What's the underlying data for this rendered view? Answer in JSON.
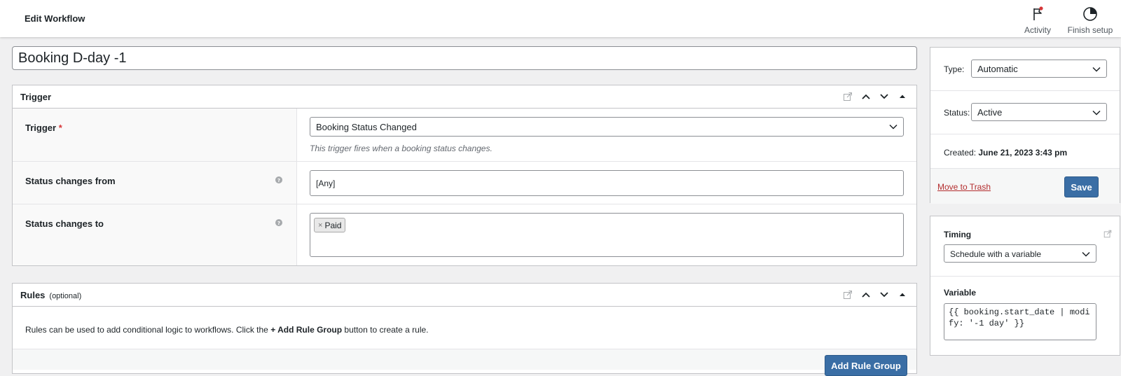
{
  "header": {
    "title": "Edit Workflow",
    "actions": [
      {
        "label": "Activity",
        "icon": "flag-icon"
      },
      {
        "label": "Finish setup",
        "icon": "progress-icon"
      }
    ]
  },
  "workflow": {
    "title_value": "Booking D-day -1"
  },
  "trigger_box": {
    "heading": "Trigger",
    "fields": [
      {
        "label": "Trigger",
        "required_mark": "*",
        "value": "Booking Status Changed",
        "description": "This trigger fires when a booking status changes."
      },
      {
        "label": "Status changes from",
        "value": "[Any]"
      },
      {
        "label": "Status changes to",
        "chip_remove": "×",
        "chip": "Paid"
      }
    ]
  },
  "rules_box": {
    "heading": "Rules",
    "optional": "(optional)",
    "text_before": "Rules can be used to add conditional logic to workflows. Click the ",
    "text_bold": "+ Add Rule Group",
    "text_after": " button to create a rule.",
    "add_button": "Add Rule Group"
  },
  "sidebar": {
    "type_label": "Type:",
    "type_value": "Automatic",
    "status_label": "Status:",
    "status_value": "Active",
    "created_label": "Created:",
    "created_value": "June 21, 2023 3:43 pm",
    "trash_link": "Move to Trash",
    "save_button": "Save"
  },
  "timing": {
    "heading": "Timing",
    "select_value": "Schedule with a variable",
    "variable_label": "Variable",
    "variable_value": "{{ booking.start_date | modify: '-1 day' }}"
  },
  "colors": {
    "primary_button": "#3a6ea5",
    "required": "#d63638",
    "trash_link": "#b32d2e",
    "activity_dot": "#d63638"
  }
}
